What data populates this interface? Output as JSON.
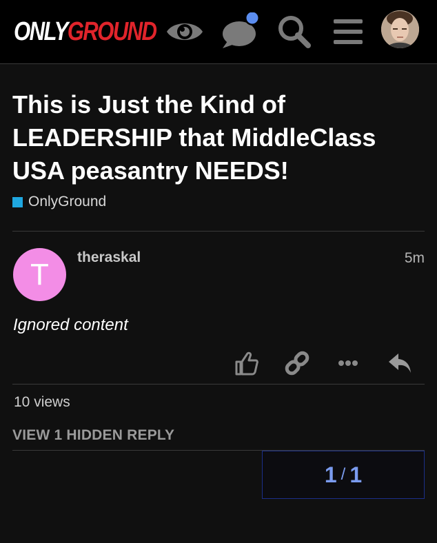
{
  "header": {
    "logo_part1": "ONLY",
    "logo_part2": "GROUND",
    "icons": [
      "eye-icon",
      "chat-bubble-icon",
      "search-icon",
      "hamburger-menu-icon"
    ],
    "avatar_icon": "user-avatar",
    "notification_color": "#5b8def"
  },
  "topic": {
    "title": "This is Just the Kind of LEADERSHIP that MiddleClass USA peasantry NEEDS!",
    "category": "OnlyGround",
    "category_color": "#1fa7e0"
  },
  "post": {
    "avatar_letter": "T",
    "avatar_color": "#f38de6",
    "username": "theraskal",
    "time": "5m",
    "body": "Ignored content",
    "actions": [
      "like-icon",
      "link-icon",
      "more-icon",
      "reply-icon"
    ]
  },
  "footer": {
    "views": "10 views",
    "hidden_reply": "VIEW 1 HIDDEN REPLY"
  },
  "progress": {
    "current": "1",
    "separator": "/",
    "total": "1"
  }
}
